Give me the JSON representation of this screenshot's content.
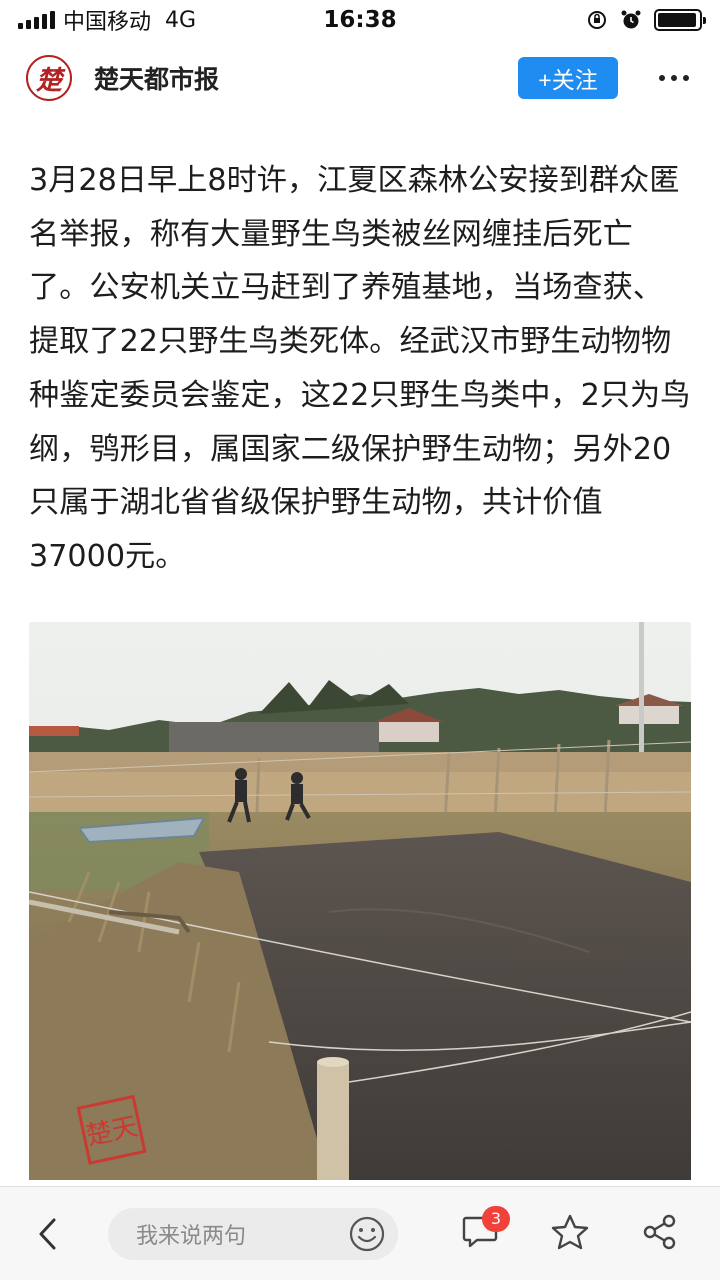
{
  "status_bar": {
    "carrier": "中国移动",
    "network": "4G",
    "time": "16:38",
    "battery_level": 0.95
  },
  "header": {
    "logo_text": "楚",
    "account_name": "楚天都市报",
    "follow_label": "+关注",
    "accent_color": "#1e8cf0"
  },
  "article": {
    "paragraph": "3月28日早上8时许，江夏区森林公安接到群众匿名举报，称有大量野生鸟类被丝网缠挂后死亡了。公安机关立马赶到了养殖基地，当场查获、提取了22只野生鸟类死体。经武汉市野生动物物种鉴定委员会鉴定，这22只野生鸟类中，2只为鸟纲，鸮形目，属国家二级保护野生动物；另外20只属于湖北省省级保护野生动物，共计价值37000元。"
  },
  "photo": {
    "watermark_text": "楚天"
  },
  "bottom_bar": {
    "comment_placeholder": "我来说两句",
    "comment_count": "3",
    "icons": [
      "back-icon",
      "smiley-icon",
      "comment-icon",
      "star-icon",
      "share-icon"
    ]
  }
}
